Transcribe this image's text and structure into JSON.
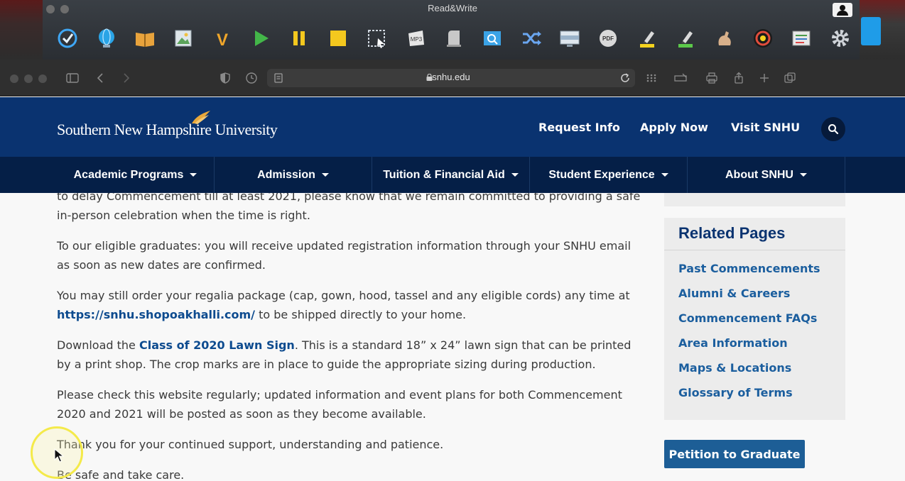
{
  "readwrite": {
    "title": "Read&Write",
    "tools": [
      {
        "name": "check-it-icon",
        "color": "#3fa7f5"
      },
      {
        "name": "globe-icon",
        "color": "#2aa4e6"
      },
      {
        "name": "dictionary-icon",
        "color": "#e8a33c"
      },
      {
        "name": "picture-dictionary-icon",
        "color": "#5ba35a"
      },
      {
        "name": "vocabulary-icon",
        "color": "#f0a62a"
      },
      {
        "name": "play-icon",
        "color": "#43b649"
      },
      {
        "name": "pause-icon",
        "color": "#f4c81e"
      },
      {
        "name": "stop-icon",
        "color": "#f4c81e"
      },
      {
        "name": "screenshot-reader-icon",
        "color": "#cfd6de"
      },
      {
        "name": "audio-maker-icon",
        "color": "#e6e6e6"
      },
      {
        "name": "scan-icon",
        "color": "#c8c8c8"
      },
      {
        "name": "web-search-icon",
        "color": "#3ba3e6"
      },
      {
        "name": "translator-icon",
        "color": "#6aa6f0"
      },
      {
        "name": "screen-masking-icon",
        "color": "#9bb3c9"
      },
      {
        "name": "pdf-reader-icon",
        "color": "#d9d9d9"
      },
      {
        "name": "highlight-yellow-icon",
        "color": "#f4d21e"
      },
      {
        "name": "highlight-green-icon",
        "color": "#5cc84a"
      },
      {
        "name": "practice-reading-icon",
        "color": "#d8b08a"
      },
      {
        "name": "audio-recorder-icon",
        "color": "#e24d3c"
      },
      {
        "name": "vocab-list-icon",
        "color": "#e8e8e8"
      },
      {
        "name": "settings-gear-icon",
        "color": "#cfd3d8"
      }
    ]
  },
  "browser": {
    "url": "snhu.edu"
  },
  "site": {
    "logo_text": "Southern New Hampshire University",
    "top_links": {
      "request_info": "Request Info",
      "apply_now": "Apply Now",
      "visit": "Visit SNHU"
    },
    "nav": [
      "Academic Programs",
      "Admission",
      "Tuition & Financial Aid",
      "Student Experience",
      "About SNHU"
    ],
    "colors": {
      "header_bg": "#0a3370",
      "nav_bg": "#051f47",
      "link": "#0d4b8f",
      "button": "#1d5e96"
    }
  },
  "article": {
    "p1": "to delay Commencement till at least 2021, please know that we remain committed to providing a safe in-person celebration when the time is right.",
    "p2": "To our eligible graduates: you will receive updated registration information through your SNHU email as soon as new dates are confirmed.",
    "p3_pre": "You may still order your regalia package (cap, gown, hood, tassel and any eligible cords) any time at ",
    "p3_link": "https://snhu.shopoakhalli.com/",
    "p3_post": " to be shipped directly to your home.",
    "p4_pre": "Download the ",
    "p4_link": "Class of 2020 Lawn Sign",
    "p4_post": ". This is a standard 18” x 24” lawn sign that can be printed by a print shop. The crop marks are in place to guide the appropriate sizing during production.",
    "p5": "Please check this website regularly; updated information and event plans for both Commencement 2020 and 2021 will be posted as soon as they become available.",
    "p6": "Thank you for your continued support, understanding and patience.",
    "p7": "Be safe and take care."
  },
  "sidebar": {
    "related_title": "Related Pages",
    "links": [
      "Past Commencements",
      "Alumni & Careers",
      "Commencement FAQs",
      "Area Information",
      "Maps & Locations",
      "Glossary of Terms"
    ],
    "petition_button": "Petition to Graduate"
  }
}
